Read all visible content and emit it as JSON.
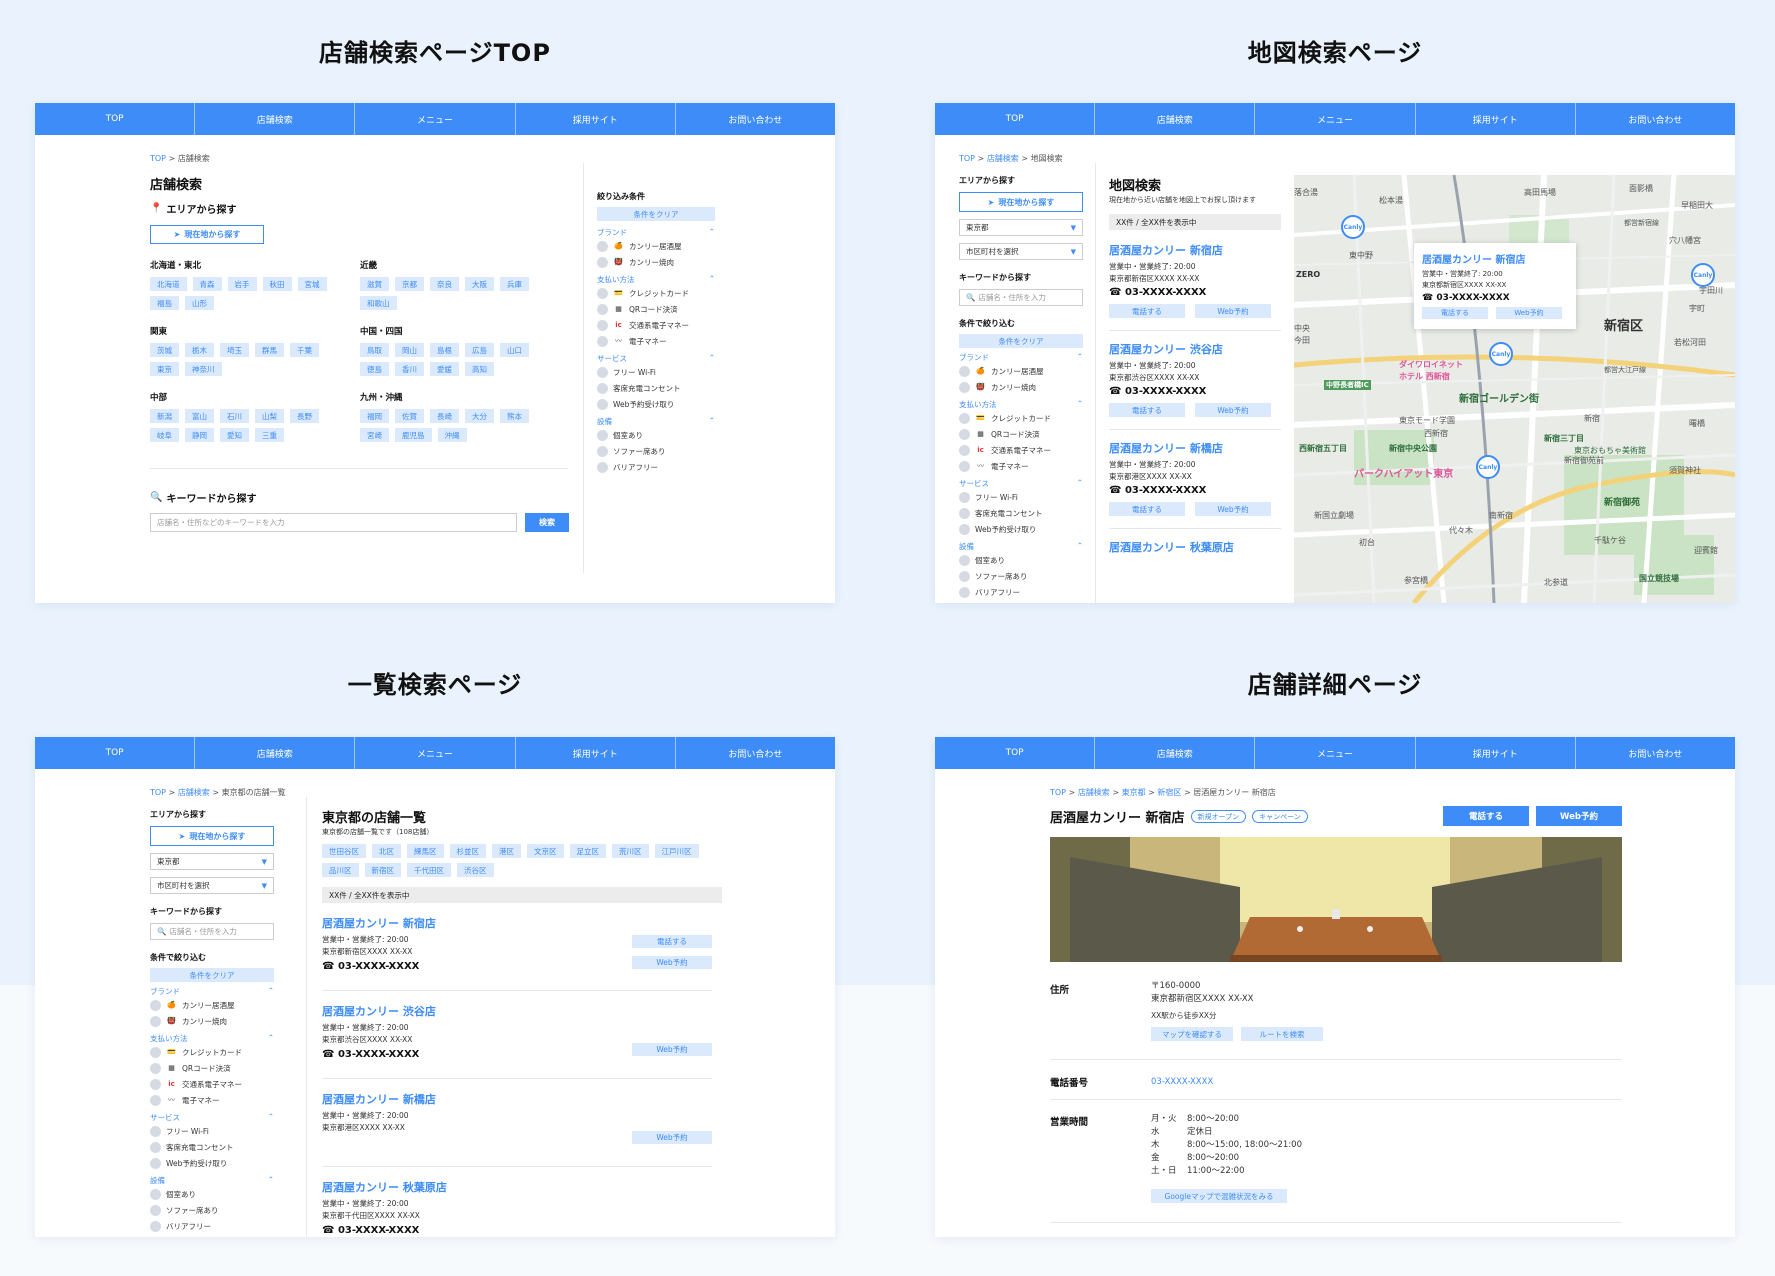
{
  "sections": {
    "top": "店舗検索ページTOP",
    "map": "地図検索ページ",
    "list": "一覧検索ページ",
    "detail": "店舗詳細ページ"
  },
  "nav": [
    "TOP",
    "店舗検索",
    "メニュー",
    "採用サイト",
    "お問い合わせ"
  ],
  "common": {
    "crumb_top": "TOP",
    "crumb_search": "店舗検索",
    "area_search": "エリアから探す",
    "current_location": "現在地から探す",
    "keyword_search": "キーワードから探す",
    "keyword_placeholder_long": "店舗名・住所などのキーワードを入力",
    "keyword_placeholder_short": "店舗名・住所を入力",
    "search_button": "検索",
    "filter_title": "絞り込み条件",
    "filter_title_side": "条件で絞り込む",
    "clear_filter": "条件をクリア",
    "prefecture": "東京都",
    "city_placeholder": "市区町村を選択",
    "call": "電話する",
    "web_reserve": "Web予約",
    "count_text": "XX件 / 全XX件を表示中"
  },
  "filters": {
    "brand": {
      "label": "ブランド",
      "items": [
        "カンリー居酒屋",
        "カンリー焼肉"
      ]
    },
    "payment": {
      "label": "支払い方法",
      "items": [
        "クレジットカード",
        "QRコード決済",
        "交通系電子マネー",
        "電子マネー"
      ]
    },
    "service": {
      "label": "サービス",
      "items": [
        "フリー Wi-Fi",
        "客席充電コンセント",
        "Web予約受け取り"
      ]
    },
    "facility": {
      "label": "設備",
      "items": [
        "個室あり",
        "ソファー席あり",
        "バリアフリー"
      ]
    }
  },
  "regions": [
    {
      "name": "北海道・東北",
      "prefs": [
        "北海道",
        "青森",
        "岩手",
        "秋田",
        "宮城",
        "福島",
        "山形"
      ]
    },
    {
      "name": "近畿",
      "prefs": [
        "滋賀",
        "京都",
        "奈良",
        "大阪",
        "兵庫",
        "和歌山"
      ]
    },
    {
      "name": "関東",
      "prefs": [
        "茨城",
        "栃木",
        "埼玉",
        "群馬",
        "千葉",
        "東京",
        "神奈川"
      ]
    },
    {
      "name": "中国・四国",
      "prefs": [
        "鳥取",
        "岡山",
        "島根",
        "広島",
        "山口",
        "徳島",
        "香川",
        "愛媛",
        "高知"
      ]
    },
    {
      "name": "中部",
      "prefs": [
        "新潟",
        "富山",
        "石川",
        "山梨",
        "長野",
        "岐阜",
        "静岡",
        "愛知",
        "三重"
      ]
    },
    {
      "name": "九州・沖縄",
      "prefs": [
        "福岡",
        "佐賀",
        "長崎",
        "大分",
        "熊本",
        "宮崎",
        "鹿児島",
        "沖縄"
      ]
    }
  ],
  "map_page": {
    "crumb_current": "地図検索",
    "title": "地図検索",
    "desc": "現在地から近い店舗を地図上でお探し頂けます",
    "stores": [
      {
        "name": "居酒屋カンリー 新宿店",
        "hours": "営業中・営業終了: 20:00",
        "addr": "東京都新宿区XXXX XX-XX",
        "tel": "03-XXXX-XXXX"
      },
      {
        "name": "居酒屋カンリー 渋谷店",
        "hours": "営業中・営業終了: 20:00",
        "addr": "東京都渋谷区XXXX XX-XX",
        "tel": "03-XXXX-XXXX"
      },
      {
        "name": "居酒屋カンリー 新橋店",
        "hours": "営業中・営業終了: 20:00",
        "addr": "東京都港区XXXX XX-XX",
        "tel": "03-XXXX-XXXX"
      },
      {
        "name": "居酒屋カンリー 秋葉原店"
      }
    ],
    "popup": {
      "name": "居酒屋カンリー 新宿店",
      "hours": "営業中・営業終了: 20:00",
      "addr": "東京都新宿区XXXX XX-XX",
      "tel": "03-XXXX-XXXX"
    },
    "pin_label": "Canly",
    "labels": [
      "高田馬場",
      "面影橋",
      "早稲田大",
      "松本湯",
      "穴八幡宮",
      "東中野",
      "ZERO",
      "新宿区",
      "若松河田",
      "ダイワロイネット",
      "ホテル 西新宿",
      "中野長者橋IC",
      "新宿ゴールデン街",
      "東京モード学園",
      "西新宿",
      "新宿",
      "曙橋",
      "西新宿五丁目",
      "新宿中央公園",
      "新宿三丁目",
      "新宿御苑前",
      "パークハイアット東京",
      "新国立劇場",
      "南新宿",
      "新宿御苑",
      "代々木",
      "初台",
      "千駄ケ谷",
      "参宮橋",
      "国立競技場",
      "北参道",
      "須賀神社",
      "落合湯",
      "中央",
      "東京おもちゃ美術館",
      "宇田川",
      "今田",
      "宇町",
      "都営大江戸線",
      "迎賓館",
      "都営新宿線"
    ]
  },
  "list_page": {
    "crumb_current": "東京都の店舗一覧",
    "title": "東京都の店舗一覧",
    "desc": "東京都の店舗一覧です（108店舗）",
    "wards": [
      "世田谷区",
      "北区",
      "練馬区",
      "杉並区",
      "港区",
      "文京区",
      "足立区",
      "荒川区",
      "江戸川区",
      "品川区",
      "新宿区",
      "千代田区",
      "渋谷区"
    ],
    "stores": [
      {
        "name": "居酒屋カンリー 新宿店",
        "hours": "営業中・営業終了: 20:00",
        "addr": "東京都新宿区XXXX XX-XX",
        "tel": "03-XXXX-XXXX",
        "call": true
      },
      {
        "name": "居酒屋カンリー 渋谷店",
        "hours": "営業中・営業終了: 20:00",
        "addr": "東京都渋谷区XXXX XX-XX",
        "tel": "03-XXXX-XXXX",
        "call": false
      },
      {
        "name": "居酒屋カンリー 新橋店",
        "hours": "営業中・営業終了: 20:00",
        "addr": "東京都港区XXXX XX-XX",
        "tel": "",
        "call": false
      },
      {
        "name": "居酒屋カンリー 秋葉原店",
        "hours": "営業中・営業終了: 20:00",
        "addr": "東京都千代田区XXXX XX-XX",
        "tel": "03-XXXX-XXXX",
        "call": false
      }
    ]
  },
  "detail_page": {
    "crumb_pref": "東京都",
    "crumb_city": "新宿区",
    "crumb_current": "居酒屋カンリー 新宿店",
    "title": "居酒屋カンリー 新宿店",
    "badge_new": "新規オープン",
    "badge_campaign": "キャンペーン",
    "addr_label": "住所",
    "zip": "〒160-0000",
    "addr": "東京都新宿区XXXX XX-XX",
    "access": "XX駅から徒歩XX分",
    "map_button": "マップを確認する",
    "route_button": "ルートを検索",
    "tel_label": "電話番号",
    "tel": "03-XXXX-XXXX",
    "hours_label": "営業時間",
    "hours": [
      {
        "day": "月・火",
        "time": "8:00〜20:00"
      },
      {
        "day": "水",
        "time": "定休日"
      },
      {
        "day": "木",
        "time": "8:00〜15:00, 18:00〜21:00"
      },
      {
        "day": "金",
        "time": "8:00〜20:00"
      },
      {
        "day": "土・日",
        "time": "11:00〜22:00"
      }
    ],
    "crowd_button": "Googleマップで混雑状況をみる"
  },
  "colors": {
    "accent": "#3d8cf7",
    "tag_bg": "#dbe9fd",
    "page_bg": "#eaf3fd"
  }
}
